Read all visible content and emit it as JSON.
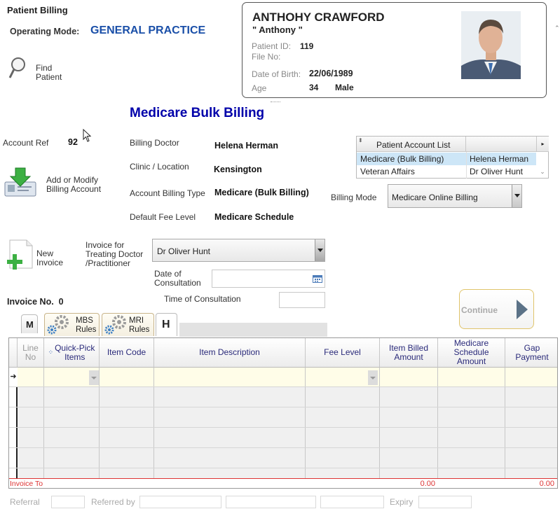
{
  "window_title": "Patient Billing",
  "operating_mode": {
    "label": "Operating Mode:",
    "value": "GENERAL PRACTICE"
  },
  "find_patient": {
    "line1": "Find",
    "line2": "Patient"
  },
  "patient": {
    "name": "ANTHOHY CRAWFORD",
    "nickname": "\" Anthony \"",
    "id_label": "Patient ID:",
    "id_value": "119",
    "file_label": "File No:",
    "file_value": "",
    "dob_label": "Date of Birth:",
    "dob_value": "22/06/1989",
    "age_label": "Age",
    "age_value": "34",
    "sex_value": "Male"
  },
  "section_title": "Medicare Bulk Billing",
  "account_ref": {
    "label": "Account Ref",
    "value": "92"
  },
  "add_modify": {
    "line1": "Add or Modify",
    "line2": "Billing Account"
  },
  "billing": {
    "doctor_label": "Billing Doctor",
    "doctor_value": "Helena Herman",
    "clinic_label": "Clinic / Location",
    "clinic_value": "Kensington",
    "type_label": "Account Billing Type",
    "type_value": "Medicare (Bulk Billing)",
    "fee_label": "Default Fee Level",
    "fee_value": "Medicare Schedule"
  },
  "account_list": {
    "header": "Patient Account List",
    "rows": [
      {
        "type": "Medicare (Bulk Billing)",
        "doctor": "Helena Herman"
      },
      {
        "type": "Veteran Affairs",
        "doctor": "Dr Oliver Hunt"
      }
    ]
  },
  "billing_mode": {
    "label": "Billing Mode",
    "value": "Medicare Online Billing"
  },
  "new_invoice": {
    "line1": "New",
    "line2": "Invoice"
  },
  "invoice_for": {
    "line1": "Invoice for",
    "line2": "Treating Doctor",
    "line3": "/Practitioner",
    "value": "Dr Oliver Hunt"
  },
  "date_of_consultation": {
    "line1": "Date of",
    "line2": "Consultation",
    "value": ""
  },
  "time_of_consultation": {
    "label": "Time of Consultation",
    "value": ""
  },
  "invoice_no": "Invoice No.  0",
  "continue_label": "Continue",
  "tabs": {
    "m": "M",
    "mbs_line1": "MBS",
    "mbs_line2": "Rules",
    "mri_line1": "MRI",
    "mri_line2": "Rules",
    "h": "H"
  },
  "grid": {
    "columns": {
      "line_no_1": "Line",
      "line_no_2": "No",
      "quick_pick_1": "Quick-Pick",
      "quick_pick_2": "Items",
      "item_code": "Item Code",
      "item_description": "Item Description",
      "fee_level": "Fee Level",
      "item_billed_1": "Item Billed",
      "item_billed_2": "Amount",
      "medicare_schedule_1": "Medicare",
      "medicare_schedule_2": "Schedule",
      "medicare_schedule_3": "Amount",
      "gap_1": "Gap",
      "gap_2": "Payment"
    },
    "footer_label": "Invoice To",
    "footer_billed_total": "0.00",
    "footer_gap_total": "0.00"
  },
  "bottom": {
    "referral_label": "Referral",
    "referred_by_label": "Referred by",
    "expiry_label": "Expiry"
  },
  "colors": {
    "accent_blue": "#1a4fa8",
    "title_blue": "#0000aa",
    "selected_row": "#cde6f7",
    "new_row": "#fffde8",
    "footer_red": "#d33333"
  }
}
